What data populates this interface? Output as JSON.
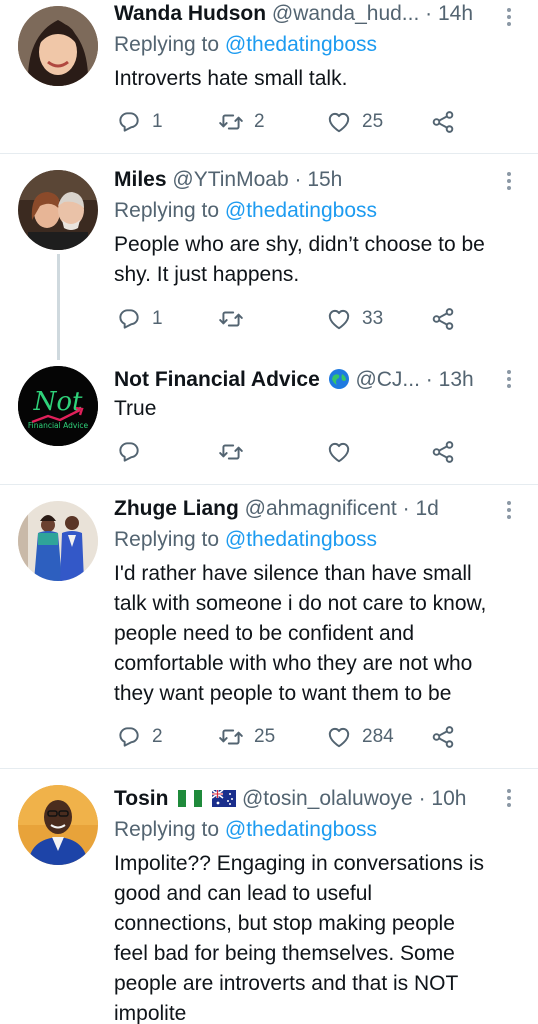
{
  "tweets": [
    {
      "name": "Wanda Hudson",
      "handle": "@wanda_hud...",
      "time": "14h",
      "replying_prefix": "Replying to",
      "replying_to": "@thedatingboss",
      "text": [
        "Introverts hate small talk."
      ],
      "replies": "1",
      "retweets": "2",
      "likes": "25"
    },
    {
      "name": "Miles",
      "handle": "@YTinMoab",
      "time": "15h",
      "replying_prefix": "Replying to",
      "replying_to": "@thedatingboss",
      "text": [
        "People who are shy, didn’t choose to be",
        "shy.  It just happens."
      ],
      "replies": "1",
      "retweets": "",
      "likes": "33"
    },
    {
      "name": "Not Financial Advice",
      "name_badge": "globe-icon",
      "handle": "@CJ...",
      "time": "13h",
      "avatar_text": "Not",
      "avatar_subtext": "Financial Advice",
      "text": [
        "True"
      ],
      "replies": "",
      "retweets": "",
      "likes": ""
    },
    {
      "name": "Zhuge Liang",
      "handle": "@ahmagnificent",
      "time": "1d",
      "replying_prefix": "Replying to",
      "replying_to": "@thedatingboss",
      "text": [
        "I'd rather have silence than have small",
        "talk with someone i do not care to know,",
        "people need to be confident and",
        "comfortable with who they are not who",
        "they want people to want them to be"
      ],
      "replies": "2",
      "retweets": "25",
      "likes": "284"
    },
    {
      "name": "Tosin",
      "flags": [
        "nigeria-flag",
        "australia-flag"
      ],
      "handle": "@tosin_olaluwoye",
      "time": "10h",
      "replying_prefix": "Replying to",
      "replying_to": "@thedatingboss",
      "text": [
        "Impolite?? Engaging in conversations is",
        "good and can lead to useful",
        "connections, but stop making people",
        "feel bad for being themselves. Some",
        "people are introverts and that is NOT",
        "impolite"
      ]
    }
  ],
  "separator": "·",
  "colors": {
    "link": "#1d9bf0",
    "secondary": "#536471",
    "divider": "#e6ecf0"
  }
}
